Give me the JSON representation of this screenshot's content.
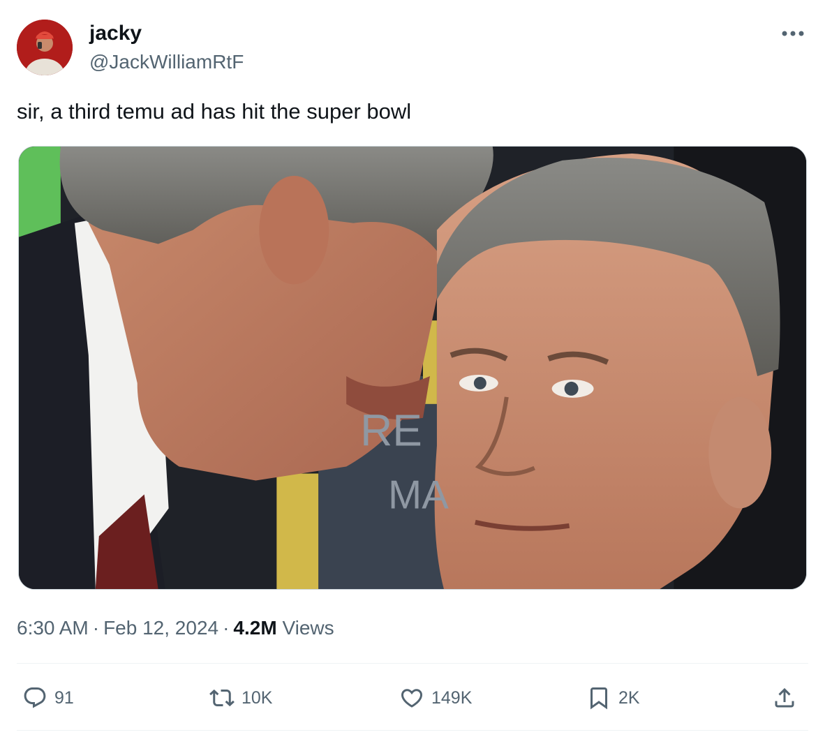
{
  "author": {
    "display_name": "jacky",
    "handle": "@JackWilliamRtF"
  },
  "tweet": {
    "text": "sir, a third temu ad has hit the super bowl",
    "media_alt": "Photo of a man whispering into another man's ear",
    "media_text": [
      "RE",
      "MA"
    ]
  },
  "meta": {
    "time": "6:30 AM",
    "separator": "·",
    "date": "Feb 12, 2024",
    "views_count": "4.2M",
    "views_label": "Views"
  },
  "actions": {
    "replies": "91",
    "reposts": "10K",
    "likes": "149K",
    "bookmarks": "2K"
  },
  "icons": {
    "more": "more-dots-icon",
    "reply": "reply-icon",
    "repost": "repost-icon",
    "like": "heart-icon",
    "bookmark": "bookmark-icon",
    "share": "share-icon"
  },
  "colors": {
    "text_primary": "#0f1419",
    "text_secondary": "#536471",
    "divider": "#eff3f4",
    "media_border": "#cfd9de"
  }
}
